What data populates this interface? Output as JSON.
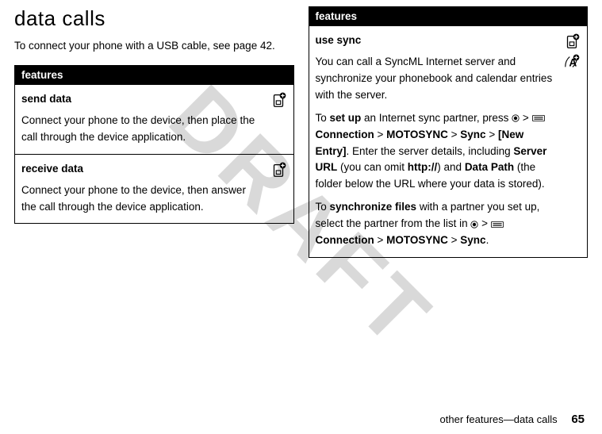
{
  "watermark": "DRAFT",
  "left": {
    "title": "data calls",
    "intro": "To connect your phone with a USB cable, see page 42.",
    "table_header": "features",
    "rows": [
      {
        "title": "send data",
        "body": "Connect your phone to the device, then place the call through the device application.",
        "icons": [
          "sim-plus"
        ]
      },
      {
        "title": "receive data",
        "body": "Connect your phone to the device, then answer the call through the device application.",
        "icons": [
          "sim-plus"
        ]
      }
    ]
  },
  "right": {
    "table_header": "features",
    "row": {
      "title": "use sync",
      "p1": "You can call a SyncML Internet server and synchronize your phonebook and calendar entries with the server.",
      "setup_prefix": "To ",
      "setup_bold": "set up",
      "setup_rest": " an Internet sync partner, press ",
      "menu_a": {
        "conn": "Connection",
        "moto": "MOTOSYNC",
        "sync": "Sync",
        "new": "[New Entry]"
      },
      "details_a": ". Enter the server details, including ",
      "server_url": "Server URL",
      "details_b": " (you can omit ",
      "http": "http://",
      "details_c": ") and ",
      "data_path": "Data Path",
      "details_d": " (the folder below the URL where your data is stored).",
      "sync_prefix": "To ",
      "sync_bold": "synchronize files",
      "sync_rest": " with a partner you set up, select the partner from the list in ",
      "menu_b": {
        "conn": "Connection",
        "moto": "MOTOSYNC",
        "sync": "Sync"
      },
      "icons": [
        "sim-plus",
        "a-plus"
      ]
    }
  },
  "footer": {
    "text": "other features—data calls",
    "page": "65"
  }
}
